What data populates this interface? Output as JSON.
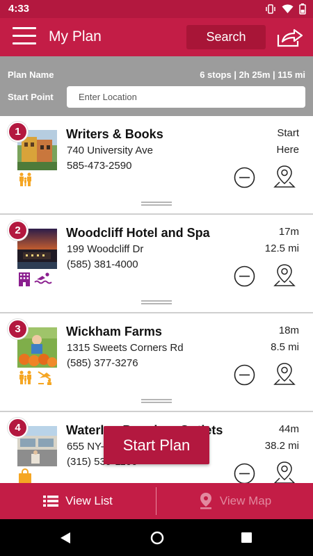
{
  "status_bar": {
    "time": "4:33"
  },
  "app_bar": {
    "title": "My Plan",
    "search_label": "Search"
  },
  "plan": {
    "name_label": "Plan Name",
    "summary": "6 stops | 2h 25m | 115 mi",
    "start_point_label": "Start Point",
    "start_point_placeholder": "Enter Location",
    "start_point_value": ""
  },
  "stops": [
    {
      "number": "1",
      "name": "Writers & Books",
      "address": "740 University Ave",
      "phone": "585-473-2590",
      "meta1": "Start",
      "meta2": "Here",
      "amenities": [
        "family-icon"
      ]
    },
    {
      "number": "2",
      "name": "Woodcliff Hotel and Spa",
      "address": "199 Woodcliff Dr",
      "phone": "(585) 381-4000",
      "meta1": "17m",
      "meta2": "12.5 mi",
      "amenities": [
        "hotel-icon",
        "swimming-icon"
      ]
    },
    {
      "number": "3",
      "name": "Wickham Farms",
      "address": "1315 Sweets Corners Rd",
      "phone": "(585) 377-3276",
      "meta1": "18m",
      "meta2": "8.5 mi",
      "amenities": [
        "family-icon",
        "outdoor-recreation-icon"
      ]
    },
    {
      "number": "4",
      "name": "Waterloo Premium Outlets",
      "address": "655 NY-318",
      "phone": "(315) 539-1100",
      "meta1": "44m",
      "meta2": "38.2 mi",
      "amenities": [
        "shopping-bag-icon"
      ]
    }
  ],
  "start_plan_label": "Start Plan",
  "bottom_bar": {
    "view_list_label": "View List",
    "view_map_label": "View Map"
  },
  "colors": {
    "brand": "#c31d46",
    "brand_dark": "#b3183f",
    "amenity_orange": "#f5a623",
    "amenity_purple": "#8b1f8f",
    "header_gray": "#9c9c9c"
  }
}
